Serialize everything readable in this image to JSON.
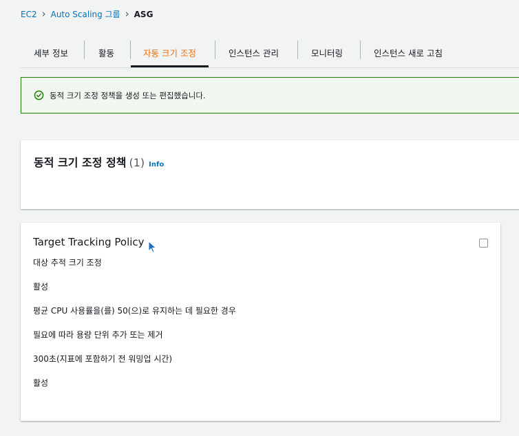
{
  "breadcrumb": {
    "items": [
      "EC2",
      "Auto Scaling 그룹"
    ],
    "current": "ASG",
    "separator": ">"
  },
  "tabs": [
    {
      "label": "세부 정보",
      "active": false
    },
    {
      "label": "활동",
      "active": false
    },
    {
      "label": "자동 크기 조정",
      "active": true
    },
    {
      "label": "인스턴스 관리",
      "active": false
    },
    {
      "label": "모니터링",
      "active": false
    },
    {
      "label": "인스턴스 새로 고침",
      "active": false
    }
  ],
  "flash": {
    "message": "동적 크기 조정 정책을 생성 또는 편집했습니다.",
    "icon": "success-check-icon"
  },
  "section": {
    "title": "동적 크기 조정 정책",
    "count": "(1)",
    "info_label": "Info"
  },
  "policy": {
    "name": "Target Tracking Policy",
    "lines": [
      "대상 추적 크기 조정",
      "활성",
      "평균 CPU 사용률을(를) 50(으)로 유지하는 데 필요한 경우",
      "필요에 따라 용량 단위 추가 또는 제거",
      "300초(지표에 포함하기 전 워밍업 시간)",
      "활성"
    ]
  },
  "colors": {
    "link": "#0073bb",
    "active_tab": "#ec7211",
    "success": "#1d8102",
    "background": "#f2f3f3"
  }
}
